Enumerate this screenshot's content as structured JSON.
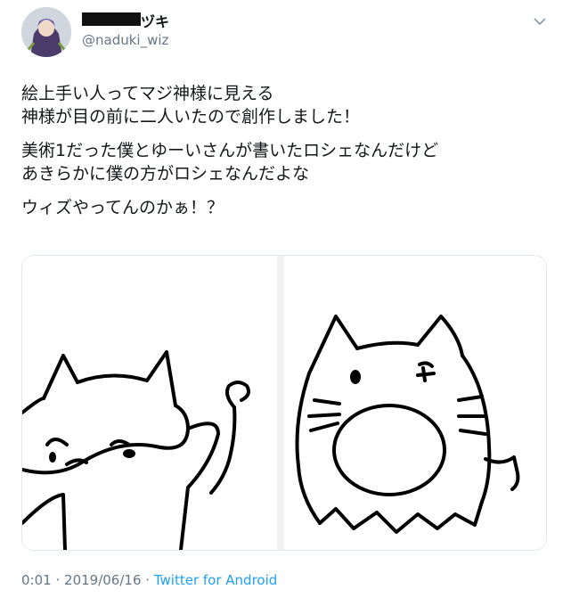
{
  "tweet": {
    "author_name_suffix": "ヅキ",
    "handle": "@naduki_wiz",
    "paragraphs": [
      "絵上手い人ってマジ神様に見える\n神様が目の前に二人いたので創作しました！",
      "美術1だった僕とゆーいさんが書いたロシェなんだけど\nあきらかに僕の方がロシェなんだよな",
      "ウィズやってんのかぁ！？"
    ],
    "time": "0:01",
    "date": "2019/06/16",
    "separator": "·",
    "source_app": "Twitter for Android"
  },
  "icons": {
    "caret": "chevron-down-icon"
  },
  "colors": {
    "text": "#14171a",
    "secondary": "#657786",
    "link": "#1da1f2",
    "border": "#e1e8ed"
  }
}
